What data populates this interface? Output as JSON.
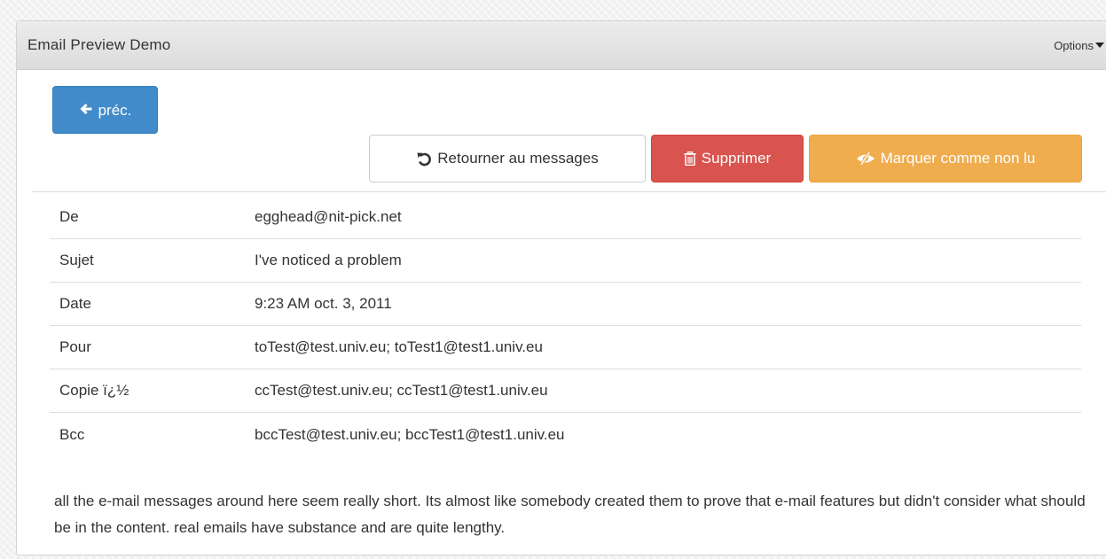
{
  "portlet": {
    "title": "Email Preview Demo",
    "options_label": "Options"
  },
  "toolbar": {
    "prev_label": "préc.",
    "return_label": "Retourner au messages",
    "delete_label": "Supprimer",
    "mark_unread_label": "Marquer comme non lu"
  },
  "icons": {
    "prev": "arrow-left-icon",
    "return": "undo-icon",
    "delete": "trash-icon",
    "mark_unread": "eye-slash-icon"
  },
  "colors": {
    "primary": "#428bca",
    "danger": "#d9534f",
    "warning": "#f0ad4e"
  },
  "email": {
    "headers": [
      {
        "label": "De",
        "value": "egghead@nit-pick.net"
      },
      {
        "label": "Sujet",
        "value": "I've noticed a problem"
      },
      {
        "label": "Date",
        "value": "9:23 AM oct. 3, 2011"
      },
      {
        "label": "Pour",
        "value": "toTest@test.univ.eu; toTest1@test1.univ.eu"
      },
      {
        "label": "Copie ï¿½",
        "value": "ccTest@test.univ.eu; ccTest1@test1.univ.eu"
      },
      {
        "label": "Bcc",
        "value": "bccTest@test.univ.eu; bccTest1@test1.univ.eu"
      }
    ],
    "body": "all the e-mail messages around here seem really short. Its almost like somebody created them to prove that e-mail features but didn't consider what should be in the content. real emails have substance and are quite lengthy."
  }
}
